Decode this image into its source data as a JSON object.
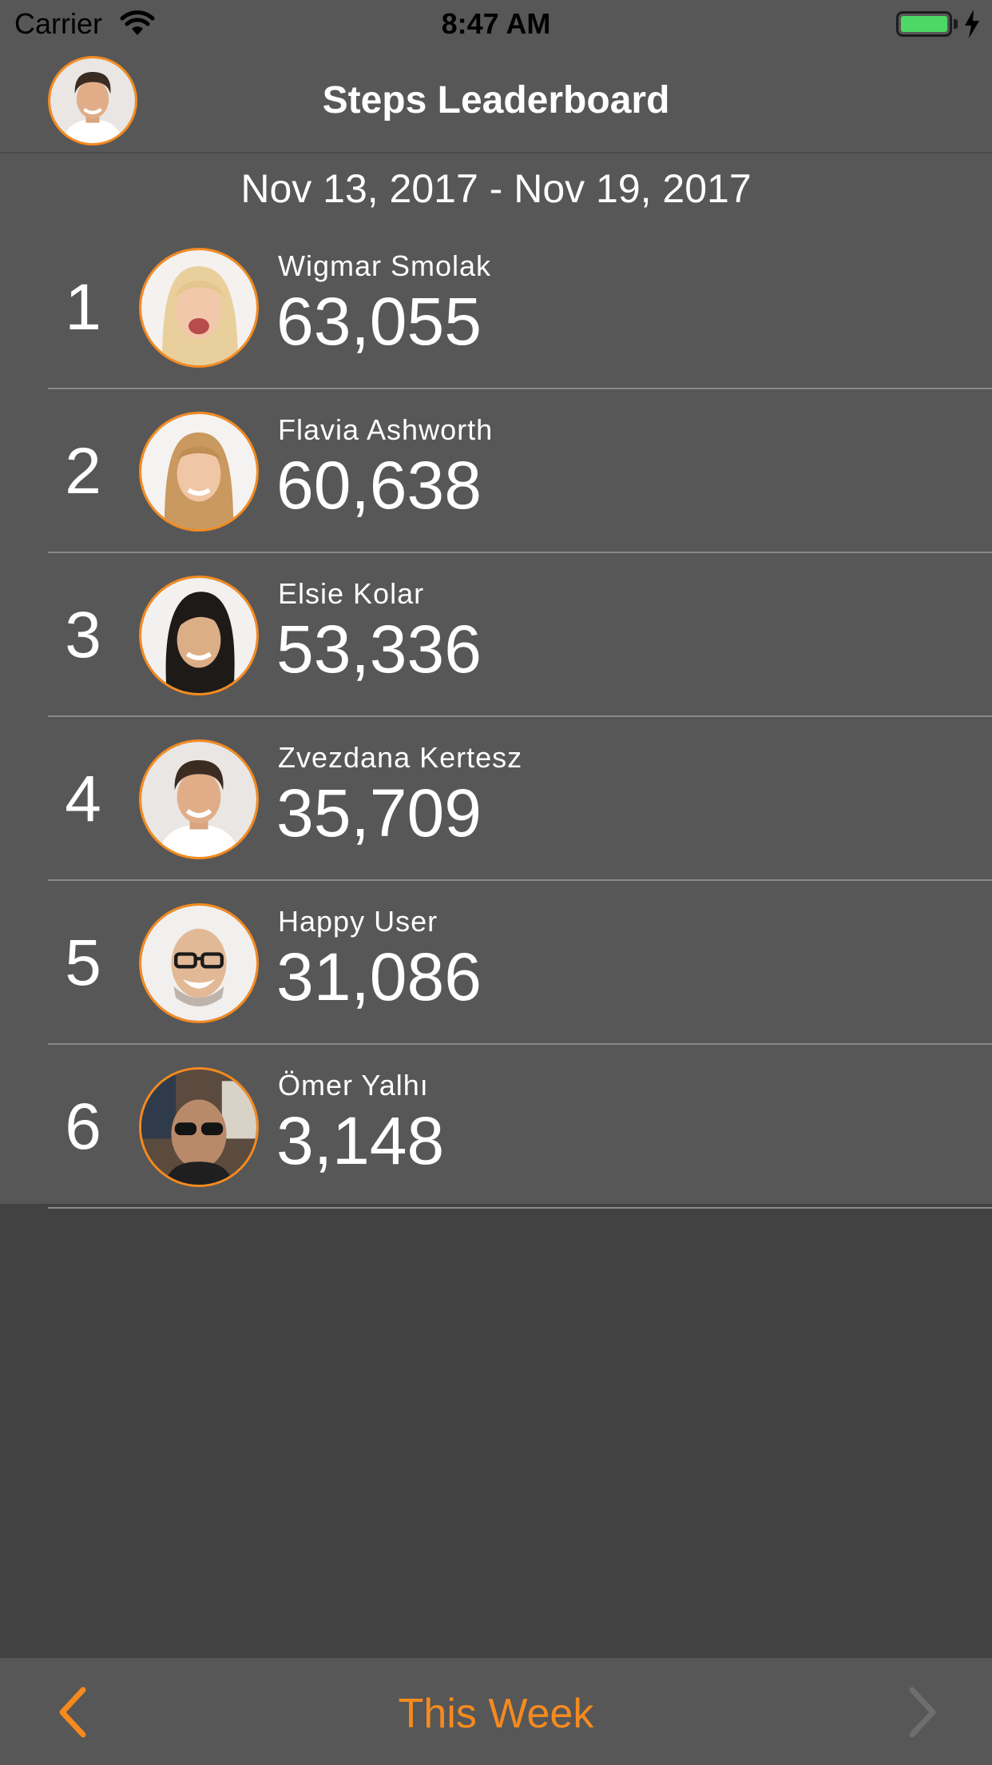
{
  "status_bar": {
    "carrier": "Carrier",
    "time": "8:47 AM",
    "battery_color": "#4cd964"
  },
  "nav": {
    "title": "Steps Leaderboard",
    "avatar_icon": "user-avatar"
  },
  "date_range": "Nov 13, 2017 - Nov 19, 2017",
  "leaderboard": [
    {
      "rank": "1",
      "name": "Wigmar Smolak",
      "steps": "63,055"
    },
    {
      "rank": "2",
      "name": "Flavia Ashworth",
      "steps": "60,638"
    },
    {
      "rank": "3",
      "name": "Elsie Kolar",
      "steps": "53,336"
    },
    {
      "rank": "4",
      "name": "Zvezdana Kertesz",
      "steps": "35,709"
    },
    {
      "rank": "5",
      "name": "Happy User",
      "steps": "31,086"
    },
    {
      "rank": "6",
      "name": "Ömer Yalhı",
      "steps": "3,148"
    }
  ],
  "toolbar": {
    "period_label": "This Week",
    "prev_icon": "chevron-left-icon",
    "next_icon": "chevron-right-icon"
  },
  "colors": {
    "accent": "#f58a1f",
    "panel": "#575757",
    "background": "#424242",
    "disabled": "#6e6e6e"
  }
}
